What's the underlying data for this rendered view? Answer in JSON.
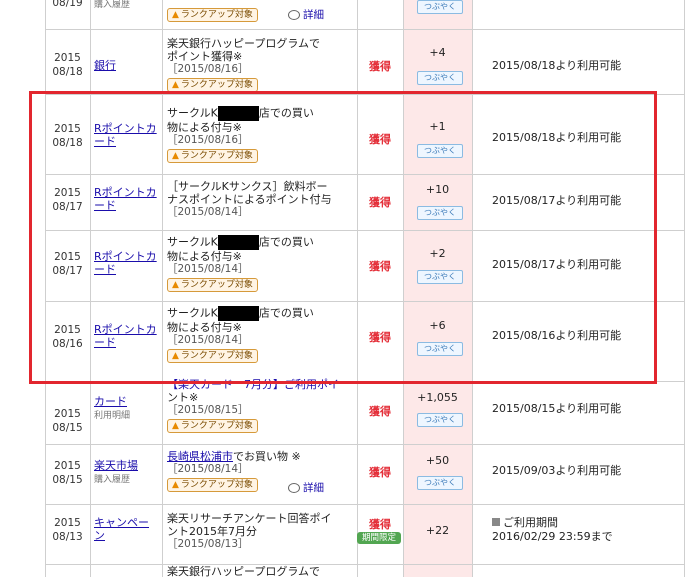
{
  "shared": {
    "rank_label": "ランクアップ対象",
    "tsubuyaku": "つぶやく",
    "detail_label": "詳細",
    "get_label": "獲得",
    "limited_label": "期間限定"
  },
  "rows": [
    {
      "date_year": "",
      "date_md": "08/19",
      "service": "",
      "service_sub": "購入履歴",
      "pts": ""
    },
    {
      "date_year": "2015",
      "date_md": "08/18",
      "service": "銀行",
      "desc_line1": "楽天銀行ハッピープログラムで",
      "desc_line2": "ポイント獲得※",
      "desc_date": "［2015/08/16］",
      "pts": "+4",
      "avail": "2015/08/18より利用可能"
    },
    {
      "date_year": "2015",
      "date_md": "08/18",
      "service": "Rポイントカード",
      "desc_line1a": "サークルK",
      "desc_line1b": "店での買い",
      "desc_line2": "物による付与※",
      "desc_date": "［2015/08/16］",
      "pts": "+1",
      "avail": "2015/08/18より利用可能"
    },
    {
      "date_year": "2015",
      "date_md": "08/17",
      "service": "Rポイントカード",
      "desc_line1": "［サークルKサンクス］飲料ボー",
      "desc_line2": "ナスポイントによるポイント付与",
      "desc_date": "［2015/08/14］",
      "pts": "+10",
      "avail": "2015/08/17より利用可能"
    },
    {
      "date_year": "2015",
      "date_md": "08/17",
      "service": "Rポイントカード",
      "desc_line1a": "サークルK",
      "desc_line1b": "店での買い",
      "desc_line2": "物による付与※",
      "desc_date": "［2015/08/14］",
      "pts": "+2",
      "avail": "2015/08/17より利用可能"
    },
    {
      "date_year": "2015",
      "date_md": "08/16",
      "service": "Rポイントカード",
      "desc_line1a": "サークルK",
      "desc_line1b": "店での買い",
      "desc_line2": "物による付与※",
      "desc_date": "［2015/08/14］",
      "pts": "+6",
      "avail": "2015/08/16より利用可能"
    },
    {
      "date_year": "2015",
      "date_md": "08/15",
      "service": "カード",
      "service_sub": "利用明細",
      "desc_line1": "【楽天カード　7月分】ご利用ポイ",
      "desc_line2": "ント※",
      "desc_date": "［2015/08/15］",
      "pts": "+1,055",
      "avail": "2015/08/15より利用可能"
    },
    {
      "date_year": "2015",
      "date_md": "08/15",
      "service": "楽天市場",
      "service_sub": "購入履歴",
      "desc_link": "長崎県松浦市",
      "desc_rest": "でお買い物 ※",
      "desc_date": "［2015/08/14］",
      "pts": "+50",
      "avail": "2015/09/03より利用可能"
    },
    {
      "date_year": "2015",
      "date_md": "08/13",
      "service": "キャンペーン",
      "desc_line1": "楽天リサーチアンケート回答ポイ",
      "desc_line2": "ント2015年7月分",
      "desc_date": "［2015/08/13］",
      "pts": "+22",
      "avail_line1": "ご利用期間",
      "avail_line2": "2016/02/29 23:59まで"
    },
    {
      "desc_line1": "楽天銀行ハッピープログラムで"
    }
  ]
}
